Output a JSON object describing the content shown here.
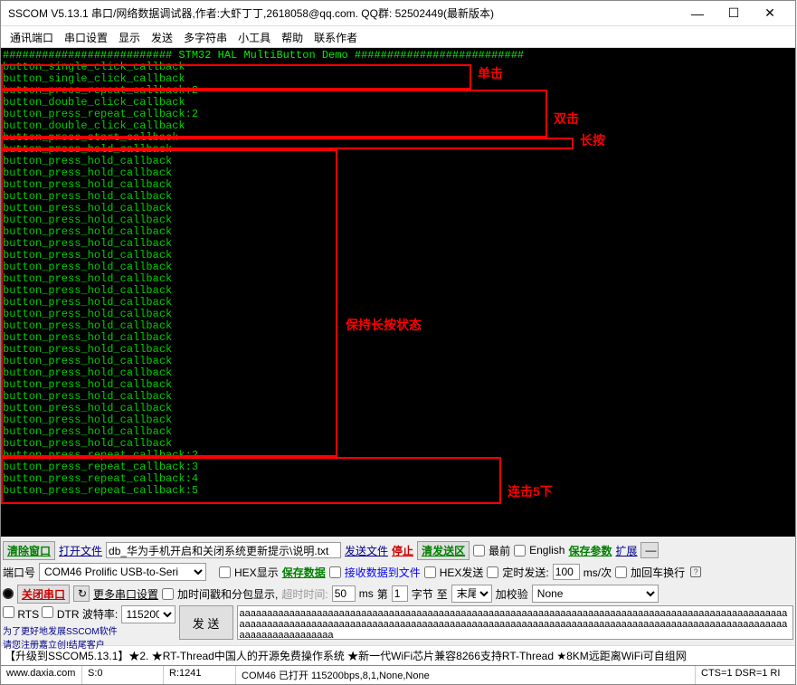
{
  "titlebar": {
    "title": "SSCOM V5.13.1 串口/网络数据调试器,作者:大虾丁丁,2618058@qq.com. QQ群: 52502449(最新版本)"
  },
  "menu": {
    "items": [
      "通讯端口",
      "串口设置",
      "显示",
      "发送",
      "多字符串",
      "小工具",
      "帮助",
      "联系作者"
    ]
  },
  "terminal": {
    "header": "########################## STM32 HAL MultiButton Demo ##########################",
    "lines": [
      "button_single_click_callback",
      "button_single_click_callback",
      "button_press_repeat_callback:2",
      "button_double_click_callback",
      "button_press_repeat_callback:2",
      "button_double_click_callback",
      "button_press_start_callback",
      "button_press_hold_callback",
      "button_press_hold_callback",
      "button_press_hold_callback",
      "button_press_hold_callback",
      "button_press_hold_callback",
      "button_press_hold_callback",
      "button_press_hold_callback",
      "button_press_hold_callback",
      "button_press_hold_callback",
      "button_press_hold_callback",
      "button_press_hold_callback",
      "button_press_hold_callback",
      "button_press_hold_callback",
      "button_press_hold_callback",
      "button_press_hold_callback",
      "button_press_hold_callback",
      "button_press_hold_callback",
      "button_press_hold_callback",
      "button_press_hold_callback",
      "button_press_hold_callback",
      "button_press_hold_callback",
      "button_press_hold_callback",
      "button_press_hold_callback",
      "button_press_hold_callback",
      "button_press_hold_callback",
      "button_press_hold_callback",
      "button_press_repeat_callback:2",
      "button_press_repeat_callback:3",
      "button_press_repeat_callback:4",
      "button_press_repeat_callback:5"
    ],
    "annotations": {
      "single": "单击",
      "double": "双击",
      "longpress": "长按",
      "hold": "保持长按状态",
      "repeat5": "连击5下"
    }
  },
  "panel": {
    "clear_window": "清除窗口",
    "open_file": "打开文件",
    "file_path": "db_华为手机开启和关闭系统更新提示\\说明.txt",
    "send_file": "发送文件",
    "stop": "停止",
    "clear_send": "清发送区",
    "top_most": "最前",
    "english": "English",
    "save_params": "保存参数",
    "expand": "扩展",
    "port_label": "端口号",
    "port_value": "COM46 Prolific USB-to-Seri",
    "hex_display": "HEX显示",
    "save_data": "保存数据",
    "recv_to_file": "接收数据到文件",
    "hex_send": "HEX发送",
    "timed_send": "定时发送:",
    "interval": "100",
    "interval_unit": "ms/次",
    "add_crlf": "加回车换行",
    "close_port": "关闭串口",
    "more_settings": "更多串口设置",
    "add_timestamp": "加时间戳和分包显示,",
    "timeout_label": "超时时间:",
    "timeout": "50",
    "timeout_unit": "ms",
    "page_label": "第",
    "page": "1",
    "page_unit": "字节",
    "tail_label": "至",
    "tail": "末尾",
    "checksum": "加校验",
    "checksum_type": "None",
    "rts": "RTS",
    "dtr": "DTR",
    "baud_label": "波特率:",
    "baud": "115200",
    "input_text": "aaaaaaaaaaaaaaaaaaaaaaaaaaaaaaaaaaaaaaaaaaaaaaaaaaaaaaaaaaaaaaaaaaaaaaaaaaaaaaaaaaaaaaaaaaaaaaaaaaaaaaaaaaaaaaaaaaaaaaaaaaaaaaaaaaaaaaaaaaaaaaaaaaaaaaaaaaaaaaaaaaaaaaaaaaaaaaaaaaaaaaaaaaaaaaaaaaaaaaaaaaaaaaaaaaaaaaa",
    "send": "发 送",
    "promo1": "为了更好地发展SSCOM软件",
    "promo2": "请您注册嘉立创!结尾客户"
  },
  "footer": {
    "text": "【升级到SSCOM5.13.1】★2. ★RT-Thread中国人的开源免费操作系统 ★新一代WiFi芯片兼容8266支持RT-Thread ★8KM远距离WiFi可自组网"
  },
  "statusbar": {
    "url": "www.daxia.com",
    "s": "S:0",
    "r": "R:1241",
    "com": "COM46 已打开 115200bps,8,1,None,None",
    "cts": "CTS=1 DSR=1 RI"
  }
}
